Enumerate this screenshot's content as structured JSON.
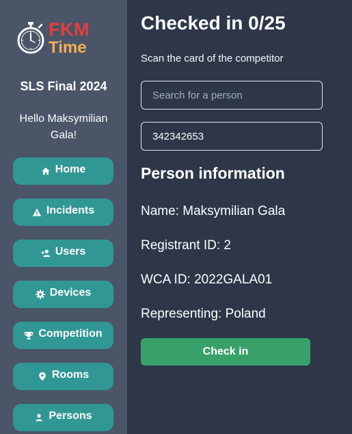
{
  "sidebar": {
    "logo": {
      "line1": "FKM",
      "line2": "Time"
    },
    "competition_name": "SLS Final 2024",
    "greeting": "Hello Maksymilian Gala!",
    "nav": [
      {
        "label": "Home",
        "icon": "home-icon"
      },
      {
        "label": "Incidents",
        "icon": "warning-icon"
      },
      {
        "label": "Users",
        "icon": "user-add-icon"
      },
      {
        "label": "Devices",
        "icon": "gear-icon"
      },
      {
        "label": "Competition",
        "icon": "trophy-icon"
      },
      {
        "label": "Rooms",
        "icon": "map-pin-icon"
      },
      {
        "label": "Persons",
        "icon": "person-icon"
      }
    ]
  },
  "main": {
    "title": "Checked in 0/25",
    "hint": "Scan the card of the competitor",
    "search_placeholder": "Search for a person",
    "card_value": "342342653",
    "section_title": "Person information",
    "info": {
      "name": "Name: Maksymilian Gala",
      "registrant_id": "Registrant ID: 2",
      "wca_id": "WCA ID: 2022GALA01",
      "representing": "Representing: Poland"
    },
    "checkin_label": "Check in"
  },
  "colors": {
    "sidebar_bg": "#4a5568",
    "main_bg": "#2d3748",
    "nav_button": "#319795",
    "checkin_button": "#38a169",
    "logo_red": "#e53e3e",
    "logo_orange": "#f6ad55"
  }
}
